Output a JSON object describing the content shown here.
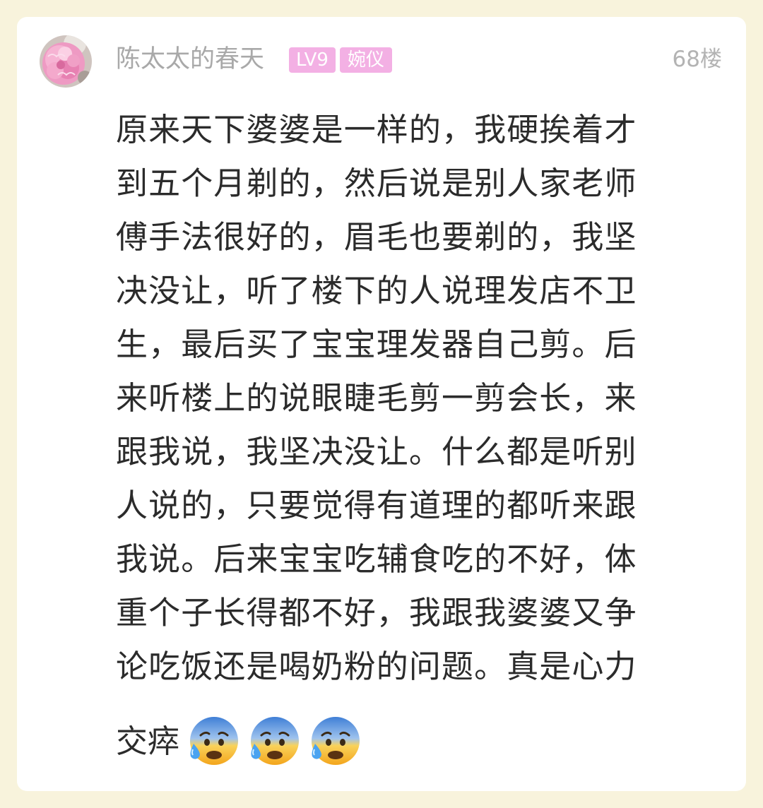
{
  "post": {
    "author": {
      "name": "陈太太的春天",
      "level_badge": "LV9",
      "title_badge": "婉仪",
      "avatar_icon": "pink-carnation-flower-avatar"
    },
    "floor": "68楼",
    "body_lines": [
      "原来天下婆婆是一样的，我硬挨着才",
      "到五个月剃的，然后说是别人家老师",
      "傅手法很好的，眉毛也要剃的，我坚",
      "决没让，听了楼下的人说理发店不卫",
      "生，最后买了宝宝理发器自己剪。后",
      "来听楼上的说眼睫毛剪一剪会长，来",
      "跟我说，我坚决没让。什么都是听别",
      "人说的，只要觉得有道理的都听来跟",
      "我说。后来宝宝吃辅食吃的不好，体",
      "重个子长得都不好，我跟我婆婆又争",
      "论吃饭还是喝奶粉的问题。真是心力"
    ],
    "last_line_text": "交瘁",
    "emojis": [
      "anxious-face-with-sweat-icon",
      "anxious-face-with-sweat-icon",
      "anxious-face-with-sweat-icon"
    ]
  },
  "colors": {
    "page_background": "#f8f3dc",
    "card_background": "#ffffff",
    "badge_pink": "#f3b0e4",
    "username_gray": "#a9a9a9",
    "body_text": "#2b2b2b"
  }
}
